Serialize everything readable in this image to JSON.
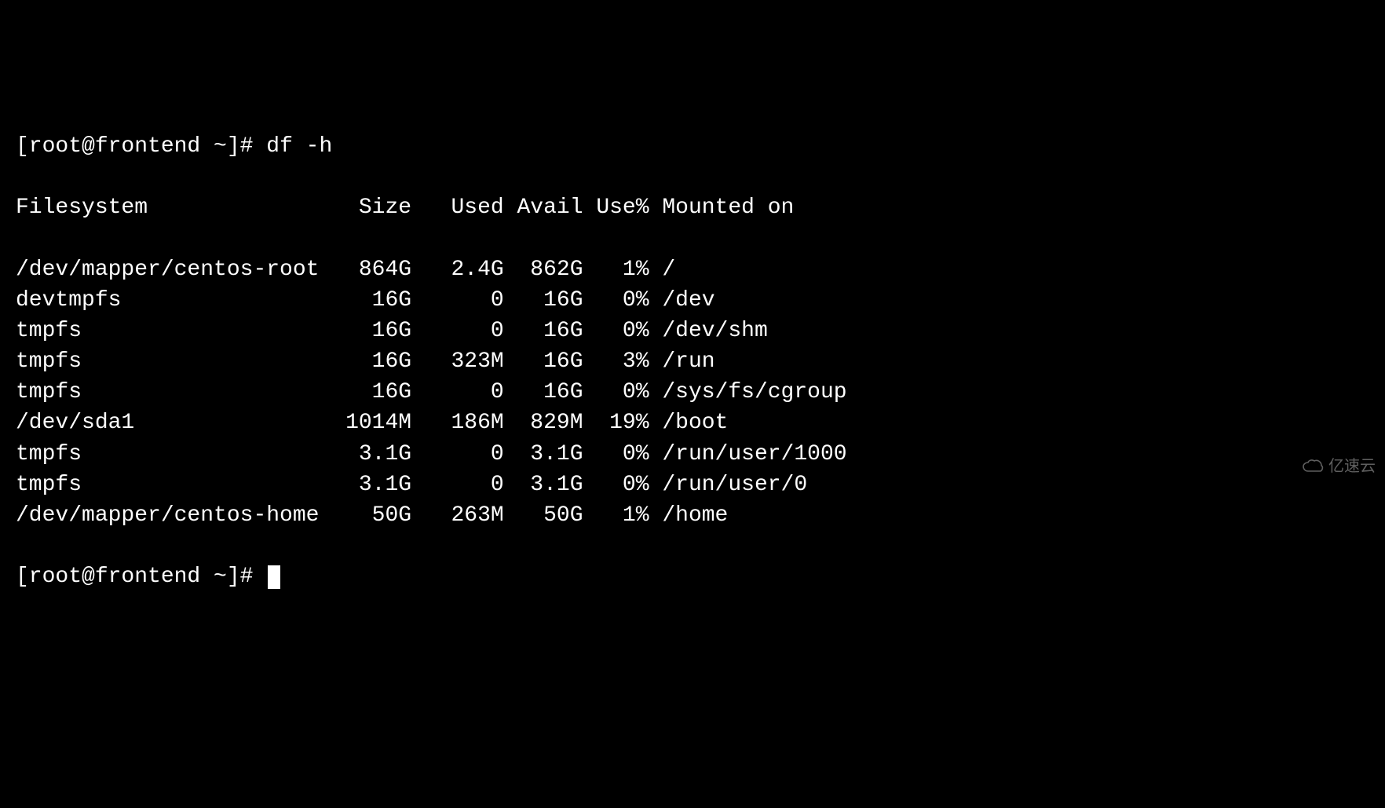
{
  "prompt": {
    "user": "root",
    "host": "frontend",
    "path": "~",
    "symbol": "#",
    "full_prefix": "[root@frontend ~]# "
  },
  "command": "df -h",
  "header": {
    "filesystem": "Filesystem",
    "size": "Size",
    "used": "Used",
    "avail": "Avail",
    "usepct": "Use%",
    "mounted": "Mounted on"
  },
  "rows": [
    {
      "filesystem": "/dev/mapper/centos-root",
      "size": "864G",
      "used": "2.4G",
      "avail": "862G",
      "usepct": "1%",
      "mounted": "/"
    },
    {
      "filesystem": "devtmpfs",
      "size": "16G",
      "used": "0",
      "avail": "16G",
      "usepct": "0%",
      "mounted": "/dev"
    },
    {
      "filesystem": "tmpfs",
      "size": "16G",
      "used": "0",
      "avail": "16G",
      "usepct": "0%",
      "mounted": "/dev/shm"
    },
    {
      "filesystem": "tmpfs",
      "size": "16G",
      "used": "323M",
      "avail": "16G",
      "usepct": "3%",
      "mounted": "/run"
    },
    {
      "filesystem": "tmpfs",
      "size": "16G",
      "used": "0",
      "avail": "16G",
      "usepct": "0%",
      "mounted": "/sys/fs/cgroup"
    },
    {
      "filesystem": "/dev/sda1",
      "size": "1014M",
      "used": "186M",
      "avail": "829M",
      "usepct": "19%",
      "mounted": "/boot"
    },
    {
      "filesystem": "tmpfs",
      "size": "3.1G",
      "used": "0",
      "avail": "3.1G",
      "usepct": "0%",
      "mounted": "/run/user/1000"
    },
    {
      "filesystem": "tmpfs",
      "size": "3.1G",
      "used": "0",
      "avail": "3.1G",
      "usepct": "0%",
      "mounted": "/run/user/0"
    },
    {
      "filesystem": "/dev/mapper/centos-home",
      "size": "50G",
      "used": "263M",
      "avail": "50G",
      "usepct": "1%",
      "mounted": "/home"
    }
  ],
  "col_widths": {
    "filesystem": 24,
    "size": 6,
    "used": 5,
    "avail": 5,
    "usepct": 4
  },
  "watermark": {
    "text": "亿速云"
  }
}
